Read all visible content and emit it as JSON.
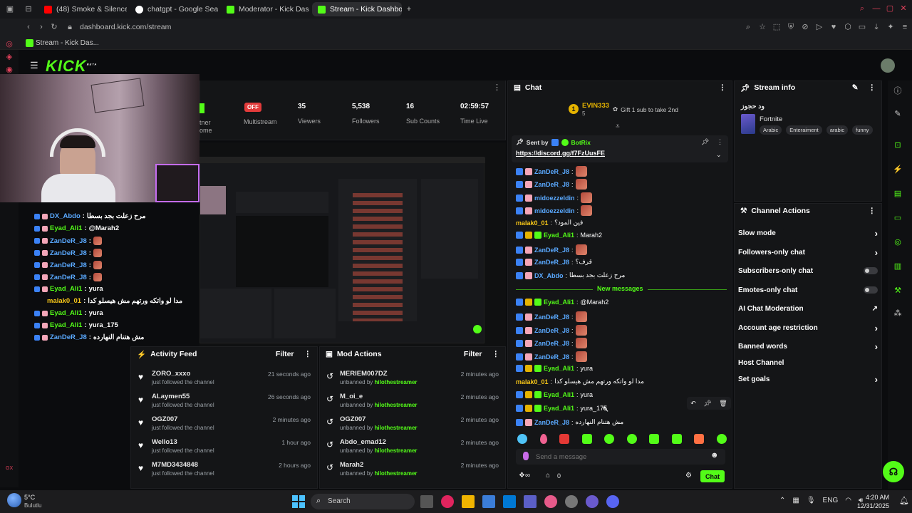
{
  "browser": {
    "tabs": [
      {
        "label": "(48) Smoke & Silence",
        "color": "#ff0000"
      },
      {
        "label": "chatgpt - Google Search",
        "color": "#ffffff"
      },
      {
        "label": "Moderator - Kick Dashbo",
        "color": "#53fc18"
      },
      {
        "label": "Stream - Kick Dashboard",
        "color": "#53fc18"
      }
    ],
    "url": "dashboard.kick.com/stream",
    "bookmark": "Stream - Kick Das..."
  },
  "kick": {
    "logo": "KICK",
    "logo_sup": "BETA"
  },
  "stats": {
    "partner_label_1": "tner",
    "partner_label_2": "ome",
    "multistream_badge": "OFF",
    "multistream_label": "Multistream",
    "viewers_value": "35",
    "viewers_label": "Viewers",
    "followers_value": "5,538",
    "followers_label": "Followers",
    "subs_value": "16",
    "subs_label": "Sub Counts",
    "time_value": "02:59:57",
    "time_label": "Time Live"
  },
  "overlay_chat": [
    {
      "user": "DX_Abdo",
      "text": "مرح زعلت بجد بسطا",
      "color": "#5aa9ff",
      "emote": false
    },
    {
      "user": "Eyad_Ali1",
      "text": "@Marah2",
      "color": "#53fc18",
      "emote": false
    },
    {
      "user": "ZanDeR_J8",
      "text": "",
      "color": "#5aa9ff",
      "emote": true
    },
    {
      "user": "ZanDeR_J8",
      "text": "",
      "color": "#5aa9ff",
      "emote": true
    },
    {
      "user": "ZanDeR_J8",
      "text": "",
      "color": "#5aa9ff",
      "emote": true
    },
    {
      "user": "ZanDeR_J8",
      "text": "",
      "color": "#5aa9ff",
      "emote": true
    },
    {
      "user": "Eyad_Ali1",
      "text": "yura",
      "color": "#53fc18",
      "emote": false
    },
    {
      "user": "malak0_01",
      "text": "مدا لو واتكه ورتهم مش هيسلو كدا",
      "color": "#f5c518",
      "emote": false
    },
    {
      "user": "Eyad_Ali1",
      "text": "yura",
      "color": "#53fc18",
      "emote": false
    },
    {
      "user": "Eyad_Ali1",
      "text": "yura_175",
      "color": "#53fc18",
      "emote": false
    },
    {
      "user": "ZanDeR_J8",
      "text": "مش هتنام النهارده",
      "color": "#5aa9ff",
      "emote": false
    }
  ],
  "activity": {
    "title": "Activity Feed",
    "filter": "Filter",
    "items": [
      {
        "user": "ZORO_xxxo",
        "action": "just followed the channel",
        "time": "21 seconds ago"
      },
      {
        "user": "ALaymen55",
        "action": "just followed the channel",
        "time": "26 seconds ago"
      },
      {
        "user": "OGZ007",
        "action": "just followed the channel",
        "time": "2 minutes ago"
      },
      {
        "user": "Wello13",
        "action": "just followed the channel",
        "time": "1 hour ago"
      },
      {
        "user": "M7MD3434848",
        "action": "just followed the channel",
        "time": "2 hours ago"
      }
    ]
  },
  "mod": {
    "title": "Mod Actions",
    "filter": "Filter",
    "unbanned_by": "unbanned by",
    "moderator": "hilothestreamer",
    "items": [
      {
        "user": "MERIEM007DZ",
        "time": "2 minutes ago"
      },
      {
        "user": "M_oi_e",
        "time": "2 minutes ago"
      },
      {
        "user": "OGZ007",
        "time": "2 minutes ago"
      },
      {
        "user": "Abdo_emad12",
        "time": "2 minutes ago"
      },
      {
        "user": "Marah2",
        "time": "2 minutes ago"
      }
    ]
  },
  "chat": {
    "title": "Chat",
    "gifter_rank": "1",
    "gifter_name": "EVIN333",
    "gifter_count": "5",
    "gift_prompt": "Gift 1 sub to take 2nd",
    "pinned_sent_by": "Sent by",
    "pinned_user": "BotRix",
    "pinned_link": "https://discord.gg/f7FzUusFE",
    "new_messages": "New messages",
    "placeholder": "Send a message",
    "send_label": "Chat",
    "viewer_count": "0",
    "messages": [
      {
        "user": "ZanDeR_J8",
        "text": "",
        "color": "#5aa9ff",
        "emote": true
      },
      {
        "user": "ZanDeR_J8",
        "text": "",
        "color": "#5aa9ff",
        "emote": true
      },
      {
        "user": "midoezzeldin",
        "text": "",
        "color": "#5aa9ff",
        "emote": true
      },
      {
        "user": "midoezzeldin",
        "text": "",
        "color": "#5aa9ff",
        "emote": true
      },
      {
        "user": "malak0_01",
        "text": "فين المود؟",
        "color": "#f5c518",
        "emote": false
      },
      {
        "user": "Eyad_Ali1",
        "text": "Marah2",
        "color": "#53fc18",
        "emote": false
      },
      {
        "user": "ZanDeR_J8",
        "text": "",
        "color": "#5aa9ff",
        "emote": true
      },
      {
        "user": "ZanDeR_J8",
        "text": "قرف؟",
        "color": "#5aa9ff",
        "emote": false
      },
      {
        "user": "DX_Abdo",
        "text": "مرح زعلت بجد بسطا",
        "color": "#5aa9ff",
        "emote": false
      }
    ],
    "new_list": [
      {
        "user": "Eyad_Ali1",
        "text": "@Marah2",
        "color": "#53fc18",
        "emote": false
      },
      {
        "user": "ZanDeR_J8",
        "text": "",
        "color": "#5aa9ff",
        "emote": true
      },
      {
        "user": "ZanDeR_J8",
        "text": "",
        "color": "#5aa9ff",
        "emote": true
      },
      {
        "user": "ZanDeR_J8",
        "text": "",
        "color": "#5aa9ff",
        "emote": true
      },
      {
        "user": "ZanDeR_J8",
        "text": "",
        "color": "#5aa9ff",
        "emote": true
      },
      {
        "user": "Eyad_Ali1",
        "text": "yura",
        "color": "#53fc18",
        "emote": false
      },
      {
        "user": "malak0_01",
        "text": "مدا لو واتكه ورتهم مش هيسلو كدا",
        "color": "#f5c518",
        "emote": false
      },
      {
        "user": "Eyad_Ali1",
        "text": "yura",
        "color": "#53fc18",
        "emote": false
      },
      {
        "user": "Eyad_Ali1",
        "text": "yura_175",
        "color": "#53fc18",
        "emote": false
      },
      {
        "user": "ZanDeR_J8",
        "text": "مش هتنام النهارده",
        "color": "#5aa9ff",
        "emote": false
      }
    ]
  },
  "stream_info": {
    "title": "Stream info",
    "stream_title": "ود حجوز",
    "category": "Fortnite",
    "tags": [
      "Arabic",
      "Enteraiment",
      "arabic",
      "funny"
    ]
  },
  "channel_actions": {
    "title": "Channel Actions",
    "items": [
      {
        "label": "Slow mode",
        "control": "chevron"
      },
      {
        "label": "Followers-only chat",
        "control": "chevron"
      },
      {
        "label": "Subscribers-only chat",
        "control": "toggle"
      },
      {
        "label": "Emotes-only chat",
        "control": "toggle"
      },
      {
        "label": "AI Chat Moderation",
        "control": "external"
      },
      {
        "label": "Account age restriction",
        "control": "chevron"
      },
      {
        "label": "Banned words",
        "control": "chevron"
      },
      {
        "label": "Host Channel",
        "control": "none"
      },
      {
        "label": "Set goals",
        "control": "chevron"
      }
    ]
  },
  "taskbar": {
    "weather_temp": "5°C",
    "weather_desc": "Bulutlu",
    "search": "Search",
    "lang": "ENG",
    "time": "4:20 AM",
    "date": "12/31/2025"
  }
}
